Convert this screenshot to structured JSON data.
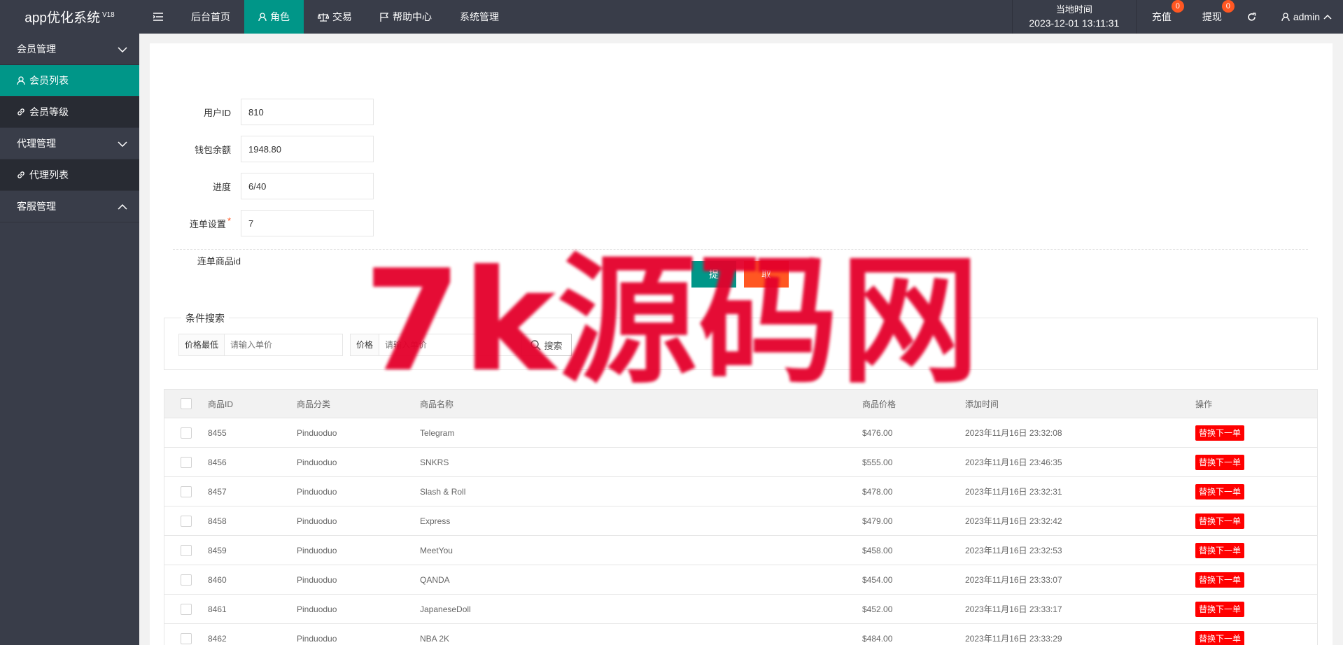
{
  "app": {
    "title": "app优化系统",
    "version": "V18"
  },
  "header": {
    "menu_icon": "menu-fold-icon",
    "nav": [
      {
        "label": "后台首页",
        "icon": ""
      },
      {
        "label": "角色",
        "icon": "user-icon"
      },
      {
        "label": "交易",
        "icon": "balance-scale-icon"
      },
      {
        "label": "帮助中心",
        "icon": "flag-icon"
      },
      {
        "label": "系统管理",
        "icon": ""
      }
    ],
    "time_label": "当地时间",
    "time_value": "2023-12-01 13:11:31",
    "recharge": {
      "label": "充值",
      "badge": "0"
    },
    "withdraw": {
      "label": "提现",
      "badge": "0"
    },
    "refresh_icon": "refresh-icon",
    "user": "admin"
  },
  "sidebar": {
    "groups": [
      {
        "label": "会员管理",
        "items": [
          {
            "label": "会员列表",
            "icon": "user-icon"
          },
          {
            "label": "会员等级",
            "icon": "link-icon"
          }
        ]
      },
      {
        "label": "代理管理",
        "items": [
          {
            "label": "代理列表",
            "icon": "link-icon"
          }
        ]
      },
      {
        "label": "客服管理",
        "items": []
      }
    ]
  },
  "form": {
    "user_id": {
      "label": "用户ID",
      "value": "810"
    },
    "balance": {
      "label": "钱包余额",
      "value": "1948.80"
    },
    "progress": {
      "label": "进度",
      "value": "6/40"
    },
    "combo": {
      "label": "连单设置",
      "required": "*",
      "value": "7"
    },
    "combo_goods": {
      "label": "连单商品id"
    },
    "submit": "提",
    "cancel": "取"
  },
  "search": {
    "legend": "条件搜索",
    "min_label": "价格最低",
    "min_placeholder": "请输入单价",
    "max_label": "价格",
    "max_placeholder": "请输入单价",
    "button": "搜索"
  },
  "table": {
    "headers": [
      "商品ID",
      "商品分类",
      "商品名称",
      "商品价格",
      "添加时间",
      "操作"
    ],
    "rows": [
      {
        "id": "8455",
        "category": "Pinduoduo",
        "name": "Telegram",
        "price": "$476.00",
        "time": "2023年11月16日 23:32:08",
        "action": "替换下一单"
      },
      {
        "id": "8456",
        "category": "Pinduoduo",
        "name": "SNKRS",
        "price": "$555.00",
        "time": "2023年11月16日 23:46:35",
        "action": "替换下一单"
      },
      {
        "id": "8457",
        "category": "Pinduoduo",
        "name": "Slash & Roll",
        "price": "$478.00",
        "time": "2023年11月16日 23:32:31",
        "action": "替换下一单"
      },
      {
        "id": "8458",
        "category": "Pinduoduo",
        "name": "Express",
        "price": "$479.00",
        "time": "2023年11月16日 23:32:42",
        "action": "替换下一单"
      },
      {
        "id": "8459",
        "category": "Pinduoduo",
        "name": "MeetYou",
        "price": "$458.00",
        "time": "2023年11月16日 23:32:53",
        "action": "替换下一单"
      },
      {
        "id": "8460",
        "category": "Pinduoduo",
        "name": "QANDA",
        "price": "$454.00",
        "time": "2023年11月16日 23:33:07",
        "action": "替换下一单"
      },
      {
        "id": "8461",
        "category": "Pinduoduo",
        "name": "JapaneseDoll",
        "price": "$452.00",
        "time": "2023年11月16日 23:33:17",
        "action": "替换下一单"
      },
      {
        "id": "8462",
        "category": "Pinduoduo",
        "name": "NBA 2K",
        "price": "$484.00",
        "time": "2023年11月16日 23:33:29",
        "action": "替换下一单"
      }
    ]
  },
  "watermark": "7k源码网",
  "colors": {
    "header_bg": "#393d49",
    "accent": "#009688",
    "danger": "#ff5722",
    "action_red": "#ff0000",
    "watermark": "#e4002b"
  }
}
